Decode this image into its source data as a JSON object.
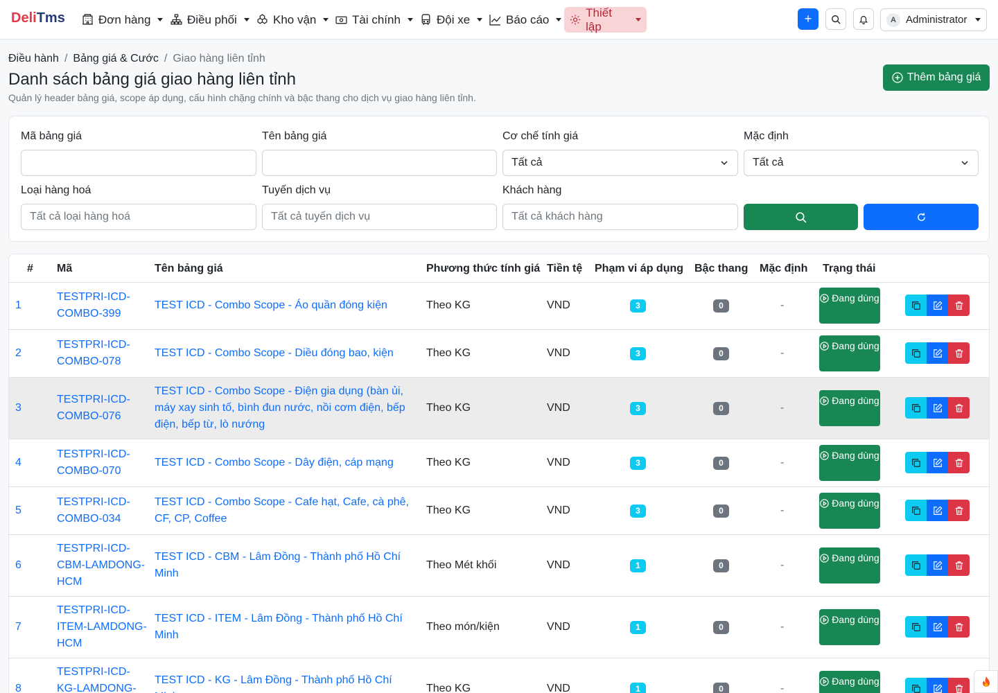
{
  "brand": {
    "part1": "Deli",
    "part2": "Tms"
  },
  "nav": [
    {
      "label": "Đơn hàng",
      "icon": "building-icon"
    },
    {
      "label": "Điều phối",
      "icon": "diagram-icon"
    },
    {
      "label": "Kho vận",
      "icon": "boxes-icon"
    },
    {
      "label": "Tài chính",
      "icon": "cash-icon"
    },
    {
      "label": "Đội xe",
      "icon": "bus-icon"
    },
    {
      "label": "Báo cáo",
      "icon": "chart-line-icon"
    },
    {
      "label": "Thiết lập",
      "icon": "gear-icon"
    }
  ],
  "user": {
    "initial": "A",
    "name": "Administrator"
  },
  "add_icon": "+",
  "breadcrumb": [
    "Điều hành",
    "Bảng giá & Cước",
    "Giao hàng liên tỉnh"
  ],
  "breadcrumb_sep": "/",
  "page": {
    "title": "Danh sách bảng giá giao hàng liên tỉnh",
    "subtitle": "Quản lý header bảng giá, scope áp dụng, cấu hình chặng chính và bậc thang cho dịch vụ giao hàng liên tỉnh.",
    "add_button": "Thêm bảng giá"
  },
  "filters": {
    "code_label": "Mã bảng giá",
    "code_value": "",
    "name_label": "Tên bảng giá",
    "name_value": "",
    "mechanism_label": "Cơ chế tính giá",
    "mechanism_value": "Tất cả",
    "default_label": "Mặc định",
    "default_value": "Tất cả",
    "goods_label": "Loại hàng hoá",
    "goods_placeholder": "Tất cả loại hàng hoá",
    "route_label": "Tuyến dịch vụ",
    "route_placeholder": "Tất cả tuyến dịch vụ",
    "customer_label": "Khách hàng",
    "customer_placeholder": "Tất cả khách hàng"
  },
  "columns": [
    "#",
    "Mã",
    "Tên bảng giá",
    "Phương thức tính giá",
    "Tiền tệ",
    "Phạm vi áp dụng",
    "Bậc thang",
    "Mặc định",
    "Trạng thái"
  ],
  "rows": [
    {
      "no": "1",
      "code": "TESTPRI-ICD-COMBO-399",
      "name": "TEST ICD - Combo Scope - Áo quần đóng kiện",
      "method": "Theo KG",
      "currency": "VND",
      "scope": "3",
      "tiers": "0",
      "default": "-",
      "status": "Đang dùng"
    },
    {
      "no": "2",
      "code": "TESTPRI-ICD-COMBO-078",
      "name": "TEST ICD - Combo Scope - Diều đóng bao, kiện",
      "method": "Theo KG",
      "currency": "VND",
      "scope": "3",
      "tiers": "0",
      "default": "-",
      "status": "Đang dùng"
    },
    {
      "no": "3",
      "code": "TESTPRI-ICD-COMBO-076",
      "name": "TEST ICD - Combo Scope - Điện gia dụng (bàn ủi, máy xay sinh tố, bình đun nước, nồi cơm điện, bếp điện, bếp từ, lò nướng",
      "method": "Theo KG",
      "currency": "VND",
      "scope": "3",
      "tiers": "0",
      "default": "-",
      "status": "Đang dùng"
    },
    {
      "no": "4",
      "code": "TESTPRI-ICD-COMBO-070",
      "name": "TEST ICD - Combo Scope - Dây điện, cáp mạng",
      "method": "Theo KG",
      "currency": "VND",
      "scope": "3",
      "tiers": "0",
      "default": "-",
      "status": "Đang dùng"
    },
    {
      "no": "5",
      "code": "TESTPRI-ICD-COMBO-034",
      "name": "TEST ICD - Combo Scope - Cafe hạt, Cafe, cà phê, CF, CP, Coffee",
      "method": "Theo KG",
      "currency": "VND",
      "scope": "3",
      "tiers": "0",
      "default": "-",
      "status": "Đang dùng"
    },
    {
      "no": "6",
      "code": "TESTPRI-ICD-CBM-LAMDONG-HCM",
      "name": "TEST ICD - CBM - Lâm Đồng - Thành phố Hồ Chí Minh",
      "method": "Theo Mét khối",
      "currency": "VND",
      "scope": "1",
      "tiers": "0",
      "default": "-",
      "status": "Đang dùng"
    },
    {
      "no": "7",
      "code": "TESTPRI-ICD-ITEM-LAMDONG-HCM",
      "name": "TEST ICD - ITEM - Lâm Đồng - Thành phố Hồ Chí Minh",
      "method": "Theo món/kiện",
      "currency": "VND",
      "scope": "1",
      "tiers": "0",
      "default": "-",
      "status": "Đang dùng"
    },
    {
      "no": "8",
      "code": "TESTPRI-ICD-KG-LAMDONG-HCM",
      "name": "TEST ICD - KG - Lâm Đồng - Thành phố Hồ Chí Minh",
      "method": "Theo KG",
      "currency": "VND",
      "scope": "1",
      "tiers": "0",
      "default": "-",
      "status": "Đang dùng"
    }
  ]
}
